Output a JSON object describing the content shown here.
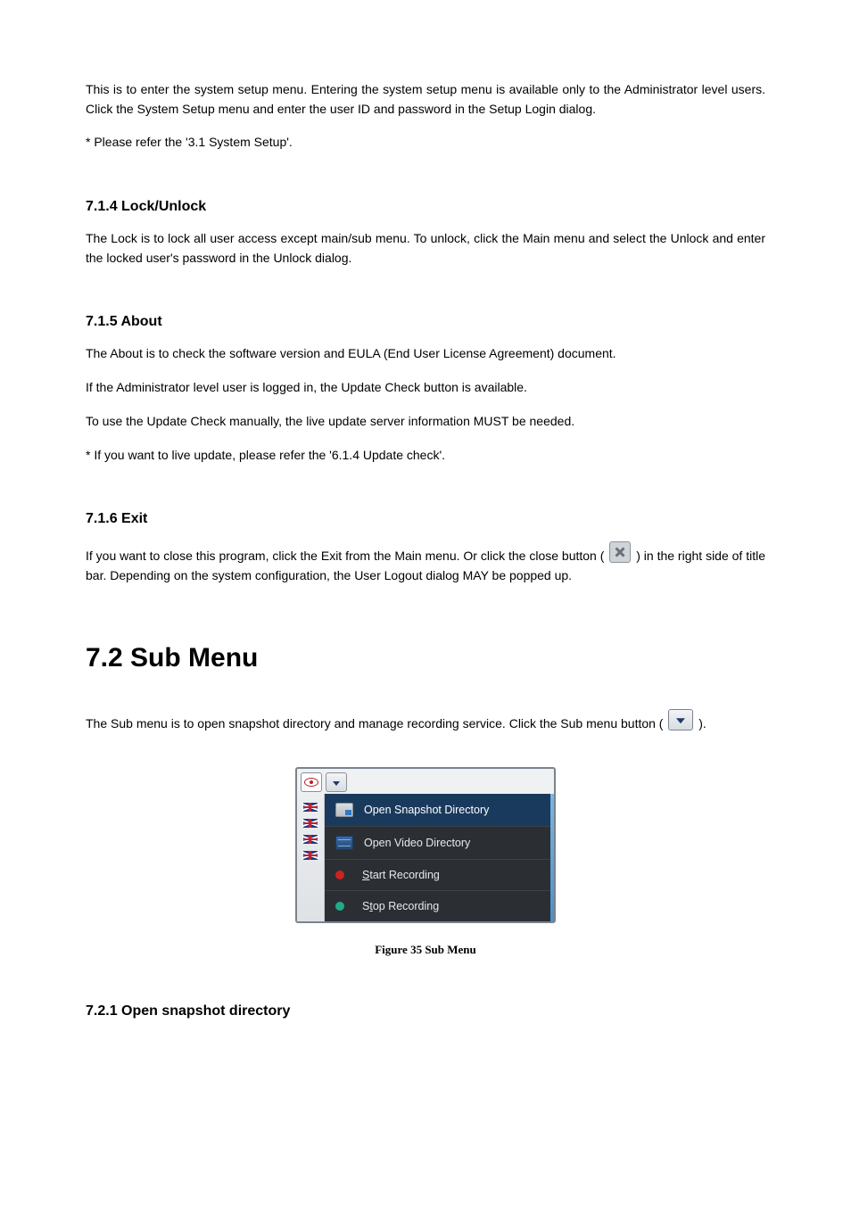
{
  "intro": {
    "p1": "This is to enter the system setup menu. Entering the system setup menu is available only to the Administrator level users. Click the System Setup menu and enter the user ID and password in the Setup Login dialog.",
    "p2": "* Please refer the '3.1 System Setup'."
  },
  "s714": {
    "heading": "7.1.4 Lock/Unlock",
    "p1": "The Lock is to lock all user access except main/sub menu. To unlock, click the Main menu and select the Unlock and enter the locked user's password in the Unlock dialog."
  },
  "s715": {
    "heading": "7.1.5 About",
    "p1": "The About is to check the software version and EULA (End User License Agreement) document.",
    "p2": "If the Administrator level user is logged in, the Update Check button is available.",
    "p3": "To use the Update Check manually, the live update server information MUST be needed.",
    "p4": "* If you want to live update, please refer the '6.1.4 Update check'."
  },
  "s716": {
    "heading": "7.1.6 Exit",
    "p1a": "If you want to close this program, click the Exit from the Main menu. Or click the close button (",
    "p1b": ") in the right side of title bar. Depending on the system configuration, the User Logout dialog MAY be popped up."
  },
  "s72": {
    "heading": "7.2 Sub Menu",
    "p1a": "The Sub menu is to open snapshot directory and manage recording service. Click the Sub menu button (",
    "p1b": ")."
  },
  "submenu": {
    "items": [
      {
        "label_pre": "Open Snapshot Directory",
        "ul": "",
        "label_post": ""
      },
      {
        "label_pre": "Open Video Directory",
        "ul": "",
        "label_post": ""
      },
      {
        "label_pre": "",
        "ul": "S",
        "label_post": "tart Recording"
      },
      {
        "label_pre": "S",
        "ul": "t",
        "label_post": "op Recording"
      }
    ]
  },
  "figure_caption": "Figure 35 Sub Menu",
  "s721": {
    "heading": "7.2.1 Open snapshot directory"
  }
}
